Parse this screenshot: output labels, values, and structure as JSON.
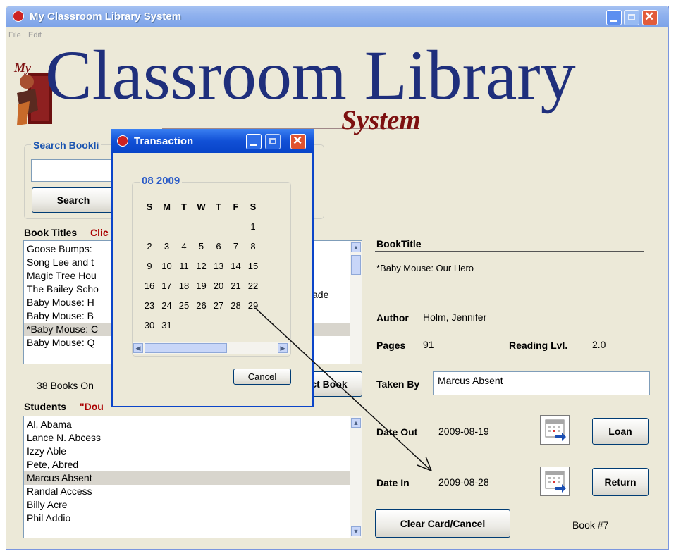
{
  "window": {
    "title": "My Classroom Library System",
    "menu": [
      "File",
      "Edit"
    ]
  },
  "logo": {
    "my": "My",
    "main": "Classroom Library",
    "system": "System"
  },
  "search": {
    "group_label": "Search Bookli",
    "input_value": "",
    "button": "Search"
  },
  "book_titles": {
    "label": "Book Titles",
    "hint": "Clic",
    "items": [
      "Goose Bumps:",
      "Song Lee and t",
      "Magic Tree Hou",
      "The Bailey Scho",
      "Baby Mouse: H",
      "Baby Mouse: B",
      "*Baby Mouse: C",
      "Baby Mouse: Q"
    ],
    "partial_right": "ade",
    "selected_index": 6,
    "count_text": "38 Books On",
    "select_button": "ct Book"
  },
  "students": {
    "label": "Students",
    "hint": "\"Dou",
    "items": [
      "Al, Abama",
      "Lance N. Abcess",
      "Izzy Able",
      "Pete, Abred",
      "Marcus Absent",
      "Randal Access",
      "Billy Acre",
      "Phil Addio"
    ],
    "selected_index": 4
  },
  "book_info": {
    "header": "BookTitle",
    "title": "*Baby Mouse: Our Hero",
    "author_label": "Author",
    "author": "Holm, Jennifer",
    "pages_label": "Pages",
    "pages": "91",
    "reading_label": "Reading Lvl.",
    "reading_level": "2.0",
    "taken_by_label": "Taken By",
    "taken_by": "Marcus Absent",
    "date_out_label": "Date Out",
    "date_out": "2009-08-19",
    "date_in_label": "Date In",
    "date_in": "2009-08-28",
    "loan_button": "Loan",
    "return_button": "Return",
    "clear_button": "Clear Card/Cancel",
    "book_number": "Book #7"
  },
  "transaction_dialog": {
    "title": "Transaction",
    "month_label": "08 2009",
    "weekdays": [
      "S",
      "M",
      "T",
      "W",
      "T",
      "F",
      "S"
    ],
    "weeks": [
      [
        "",
        "",
        "",
        "",
        "",
        "",
        "1"
      ],
      [
        "2",
        "3",
        "4",
        "5",
        "6",
        "7",
        "8"
      ],
      [
        "9",
        "10",
        "11",
        "12",
        "13",
        "14",
        "15"
      ],
      [
        "16",
        "17",
        "18",
        "19",
        "20",
        "21",
        "22"
      ],
      [
        "23",
        "24",
        "25",
        "26",
        "27",
        "28",
        "29"
      ],
      [
        "30",
        "31",
        "",
        "",
        "",
        "",
        ""
      ]
    ],
    "cancel_button": "Cancel"
  },
  "colors": {
    "window_bg": "#ece9d8",
    "title_blue": "#0844c8",
    "logo_blue": "#1f2f7c",
    "logo_red": "#7d1010",
    "hint_red": "#a00000",
    "calendar_header_blue": "#2a5bc8"
  }
}
